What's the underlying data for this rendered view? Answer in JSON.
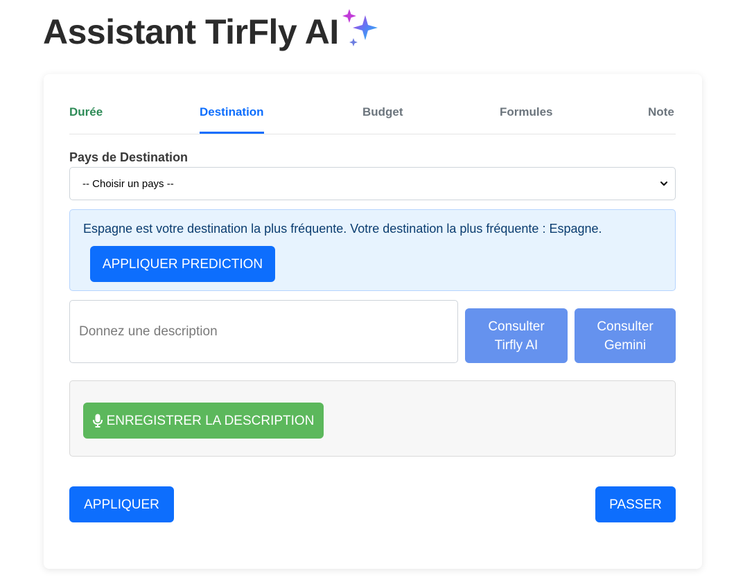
{
  "page": {
    "title": "Assistant TirFly AI",
    "sparkle_icon": "sparkle-icon"
  },
  "tabs": [
    {
      "label": "Durée",
      "state": "done"
    },
    {
      "label": "Destination",
      "state": "active"
    },
    {
      "label": "Budget",
      "state": "inactive"
    },
    {
      "label": "Formules",
      "state": "inactive"
    },
    {
      "label": "Note",
      "state": "inactive"
    }
  ],
  "destination": {
    "label": "Pays de Destination",
    "select_value": "-- Choisir un pays --"
  },
  "prediction": {
    "message": "Espagne est votre destination la plus fréquente. Votre destination la plus fréquente : Espagne.",
    "button": "APPLIQUER PREDICTION"
  },
  "description": {
    "placeholder": "Donnez une description",
    "value": "",
    "consult_tirfly": "Consulter Tirfly AI",
    "consult_gemini": "Consulter Gemini"
  },
  "record": {
    "button": "ENREGISTRER LA DESCRIPTION",
    "icon": "microphone-icon"
  },
  "footer": {
    "apply": "APPLIQUER",
    "skip": "PASSER"
  },
  "colors": {
    "primary": "#0d6efd",
    "done_tab": "#2e8b57",
    "consult_button": "#6592ee",
    "record_button": "#5cb85c",
    "alert_bg": "#e7f3fe"
  }
}
